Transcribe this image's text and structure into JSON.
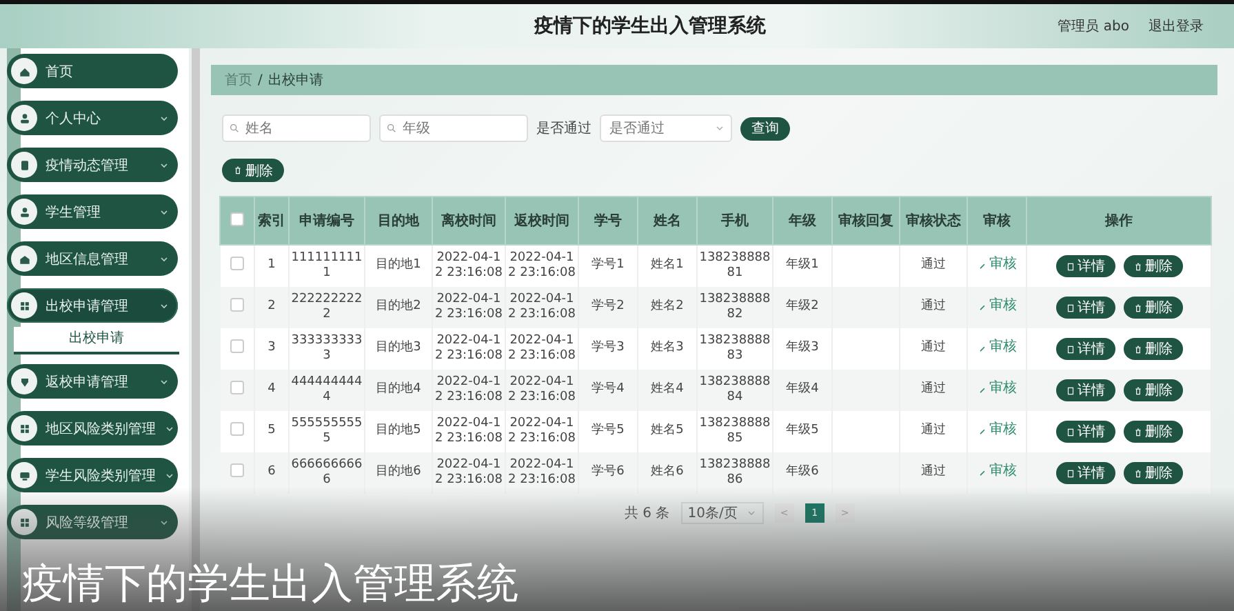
{
  "header": {
    "title": "疫情下的学生出入管理系统",
    "user": "管理员 abo",
    "logout": "退出登录"
  },
  "sidebar": {
    "items": [
      {
        "label": "首页",
        "expanded": false,
        "has_arrow": false
      },
      {
        "label": "个人中心",
        "expanded": false,
        "has_arrow": true
      },
      {
        "label": "疫情动态管理",
        "expanded": false,
        "has_arrow": true
      },
      {
        "label": "学生管理",
        "expanded": false,
        "has_arrow": true
      },
      {
        "label": "地区信息管理",
        "expanded": false,
        "has_arrow": true
      },
      {
        "label": "出校申请管理",
        "expanded": true,
        "has_arrow": true,
        "children": [
          {
            "label": "出校申请",
            "selected": true
          }
        ]
      },
      {
        "label": "返校申请管理",
        "expanded": false,
        "has_arrow": true
      },
      {
        "label": "地区风险类别管理",
        "expanded": false,
        "has_arrow": true
      },
      {
        "label": "学生风险类别管理",
        "expanded": false,
        "has_arrow": true
      },
      {
        "label": "风险等级管理",
        "expanded": false,
        "has_arrow": true
      }
    ]
  },
  "breadcrumb": [
    "首页",
    "/",
    "出校申请"
  ],
  "search": {
    "fields": [
      {
        "placeholder": "姓名"
      },
      {
        "placeholder": "年级"
      }
    ],
    "select_label": "是否通过",
    "select_placeholder": "是否通过",
    "button": "查询"
  },
  "toolbar": {
    "delete_button": "删除"
  },
  "table": {
    "header_checked": false,
    "columns": [
      "索引",
      "申请编号",
      "目的地",
      "离校时间",
      "返校时间",
      "学号",
      "姓名",
      "手机",
      "年级",
      "审核回复",
      "审核状态",
      "审核",
      "操作"
    ],
    "rows": [
      {
        "checked": false,
        "cells": [
          "1",
          "1111111111",
          "目的地1",
          "2022-04-12 23:16:08",
          "2022-04-12 23:16:08",
          "学号1",
          "姓名1",
          "13823888881",
          "年级1",
          "",
          "通过"
        ],
        "review": "审核",
        "actions": [
          "详情",
          "删除"
        ]
      },
      {
        "checked": false,
        "cells": [
          "2",
          "2222222222",
          "目的地2",
          "2022-04-12 23:16:08",
          "2022-04-12 23:16:08",
          "学号2",
          "姓名2",
          "13823888882",
          "年级2",
          "",
          "通过"
        ],
        "review": "审核",
        "actions": [
          "详情",
          "删除"
        ]
      },
      {
        "checked": false,
        "cells": [
          "3",
          "3333333333",
          "目的地3",
          "2022-04-12 23:16:08",
          "2022-04-12 23:16:08",
          "学号3",
          "姓名3",
          "13823888883",
          "年级3",
          "",
          "通过"
        ],
        "review": "审核",
        "actions": [
          "详情",
          "删除"
        ]
      },
      {
        "checked": false,
        "cells": [
          "4",
          "4444444444",
          "目的地4",
          "2022-04-12 23:16:08",
          "2022-04-12 23:16:08",
          "学号4",
          "姓名4",
          "13823888884",
          "年级4",
          "",
          "通过"
        ],
        "review": "审核",
        "actions": [
          "详情",
          "删除"
        ]
      },
      {
        "checked": false,
        "cells": [
          "5",
          "5555555555",
          "目的地5",
          "2022-04-12 23:16:08",
          "2022-04-12 23:16:08",
          "学号5",
          "姓名5",
          "13823888885",
          "年级5",
          "",
          "通过"
        ],
        "review": "审核",
        "actions": [
          "详情",
          "删除"
        ]
      },
      {
        "checked": false,
        "cells": [
          "6",
          "6666666666",
          "目的地6",
          "2022-04-12 23:16:08",
          "2022-04-12 23:16:08",
          "学号6",
          "姓名6",
          "13823888886",
          "年级6",
          "",
          "通过"
        ],
        "review": "审核",
        "actions": [
          "详情",
          "删除"
        ]
      }
    ]
  },
  "pagination": {
    "total": "共 6 条",
    "page_size": "10条/页",
    "prev": "<",
    "pages": [
      {
        "label": "1",
        "selected": true
      }
    ],
    "next": ">"
  },
  "caption": "疫情下的学生出入管理系统"
}
